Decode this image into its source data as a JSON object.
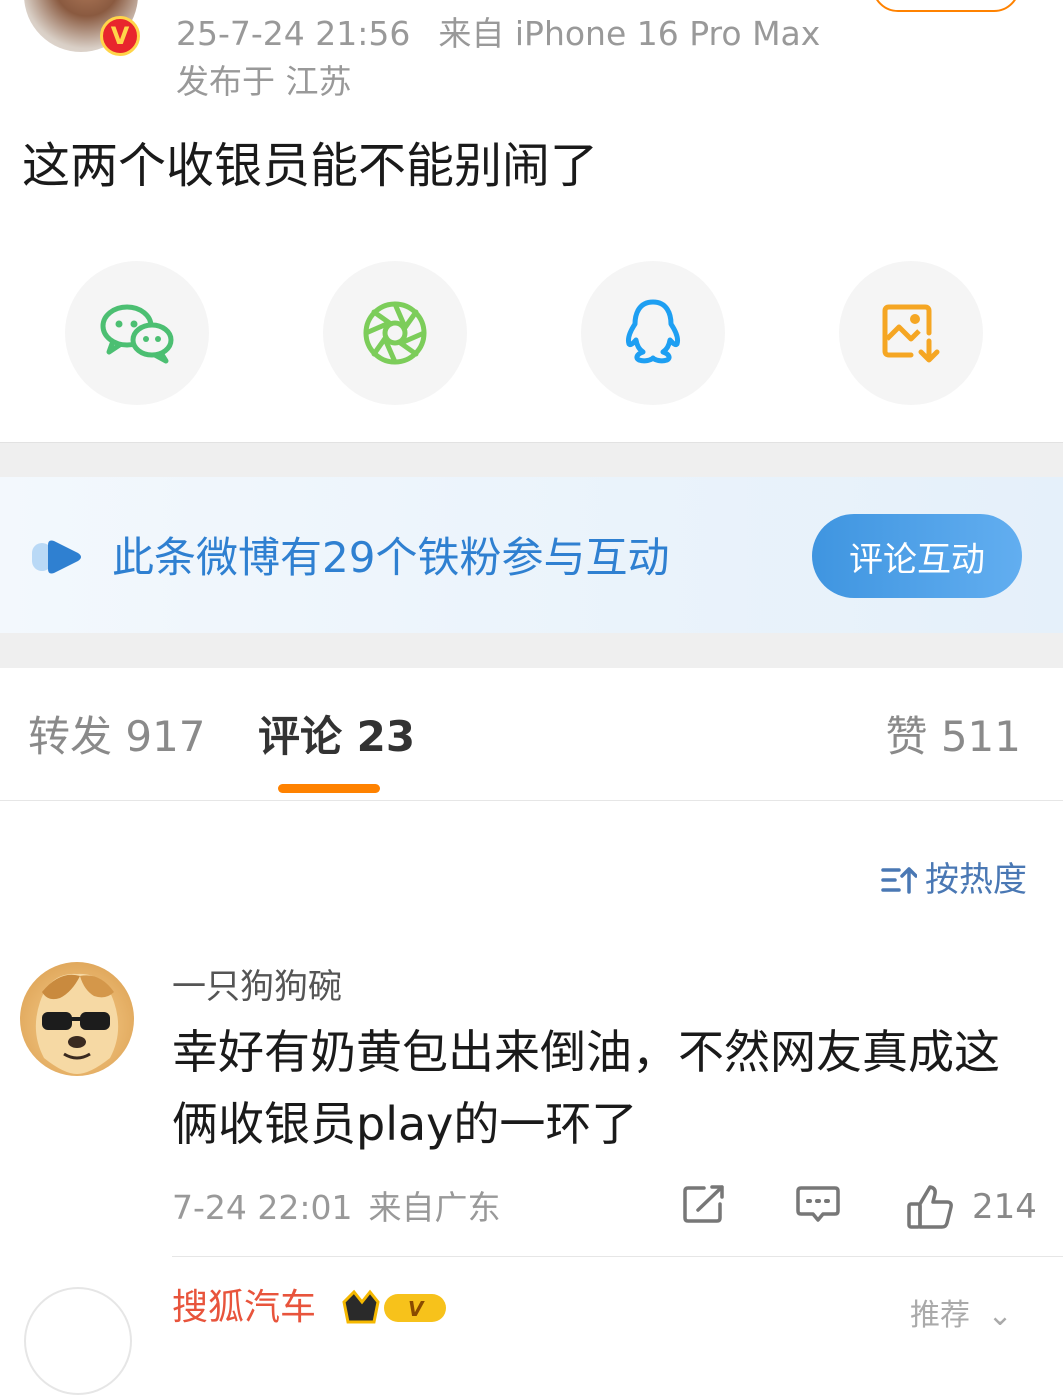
{
  "post": {
    "time": "25-7-24 21:56",
    "source": "来自 iPhone 16 Pro Max",
    "location": "发布于 江苏",
    "text": "这两个收银员能不能别闹了"
  },
  "share": {
    "icons": [
      "wechat-icon",
      "moments-icon",
      "qq-icon",
      "save-image-icon"
    ]
  },
  "fan_banner": {
    "text": "此条微博有29个铁粉参与互动",
    "button_label": "评论互动"
  },
  "tabs": {
    "repost_label": "转发 917",
    "comment_label": "评论 23",
    "like_label": "赞 511"
  },
  "sort": {
    "label": "按热度"
  },
  "comment": {
    "username": "一只狗狗碗",
    "text": "幸好有奶黄包出来倒油，不然网友真成这俩收银员play的一环了",
    "time": "7-24 22:01",
    "source": "来自广东",
    "likes": "214"
  },
  "next_comment": {
    "username": "搜狐汽车",
    "badge_text": "V",
    "right_label": "推荐"
  },
  "colors": {
    "accent": "#ff8200",
    "link_blue": "#2f80d1",
    "sort_blue": "#4a78b4"
  }
}
